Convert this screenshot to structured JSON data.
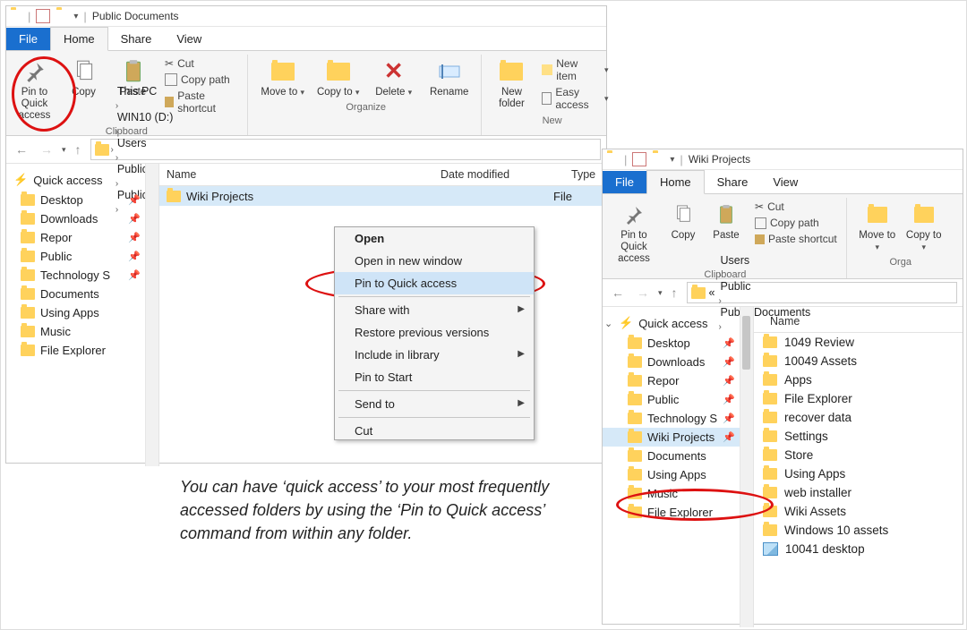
{
  "windowA": {
    "title": "Public Documents",
    "tabs": {
      "file": "File",
      "home": "Home",
      "share": "Share",
      "view": "View"
    },
    "ribbon": {
      "pin": "Pin to Quick access",
      "copy": "Copy",
      "paste": "Paste",
      "cut": "Cut",
      "copy_path": "Copy path",
      "paste_shortcut": "Paste shortcut",
      "clipboard_label": "Clipboard",
      "move": "Move to",
      "copy_to": "Copy to",
      "delete": "Delete",
      "rename": "Rename",
      "organize_label": "Organize",
      "new_folder": "New folder",
      "new_item": "New item",
      "easy_access": "Easy access",
      "new_label": "New"
    },
    "breadcrumb": [
      "This PC",
      "WIN10 (D:)",
      "Users",
      "Public",
      "Public Documents"
    ],
    "columns": {
      "name": "Name",
      "date": "Date modified",
      "type": "Type"
    },
    "sidebar": {
      "quick_access": "Quick access",
      "items": [
        "Desktop",
        "Downloads",
        "Repor",
        "Public",
        "Technology S",
        "Documents",
        "Using Apps",
        "Music",
        "File Explorer"
      ]
    },
    "file_row": {
      "name": "Wiki Projects",
      "date": "",
      "type": "File"
    },
    "context_menu": {
      "open_label": "Open",
      "open": "Open",
      "open_new": "Open in new window",
      "pin_qa": "Pin to Quick access",
      "share_with": "Share with",
      "restore": "Restore previous versions",
      "include": "Include in library",
      "pin_start": "Pin to Start",
      "send_to": "Send to",
      "cut": "Cut"
    }
  },
  "windowB": {
    "title": "Wiki Projects",
    "tabs": {
      "file": "File",
      "home": "Home",
      "share": "Share",
      "view": "View"
    },
    "ribbon": {
      "pin": "Pin to Quick access",
      "copy": "Copy",
      "paste": "Paste",
      "cut": "Cut",
      "copy_path": "Copy path",
      "paste_shortcut": "Paste shortcut",
      "clipboard_label": "Clipboard",
      "move": "Move to",
      "copy_to": "Copy to",
      "organize_label": "Orga"
    },
    "breadcrumb_prefix": "«",
    "breadcrumb": [
      "Users",
      "Public",
      "Public Documents"
    ],
    "columns": {
      "name": "Name"
    },
    "sidebar": {
      "quick_access": "Quick access",
      "items": [
        "Desktop",
        "Downloads",
        "Repor",
        "Public",
        "Technology S",
        "Wiki Projects",
        "Documents",
        "Using Apps",
        "Music",
        "File Explorer"
      ]
    },
    "files": [
      {
        "name": "1049 Review",
        "t": "folder"
      },
      {
        "name": "10049 Assets",
        "t": "folder"
      },
      {
        "name": "Apps",
        "t": "folder"
      },
      {
        "name": "File Explorer",
        "t": "folder"
      },
      {
        "name": "recover data",
        "t": "folder"
      },
      {
        "name": "Settings",
        "t": "folder"
      },
      {
        "name": "Store",
        "t": "folder"
      },
      {
        "name": "Using Apps",
        "t": "folder"
      },
      {
        "name": "web installer",
        "t": "folder"
      },
      {
        "name": "Wiki Assets",
        "t": "folder"
      },
      {
        "name": "Windows 10 assets",
        "t": "folder"
      },
      {
        "name": "10041 desktop",
        "t": "image"
      }
    ]
  },
  "caption": "You can have ‘quick access’ to your most frequently accessed folders by using the ‘Pin to Quick access’ command from within any folder.",
  "icons": {
    "arrow": "›",
    "down": "▾",
    "pin": "📌",
    "back": "←",
    "fwd": "→",
    "up": "↑"
  }
}
